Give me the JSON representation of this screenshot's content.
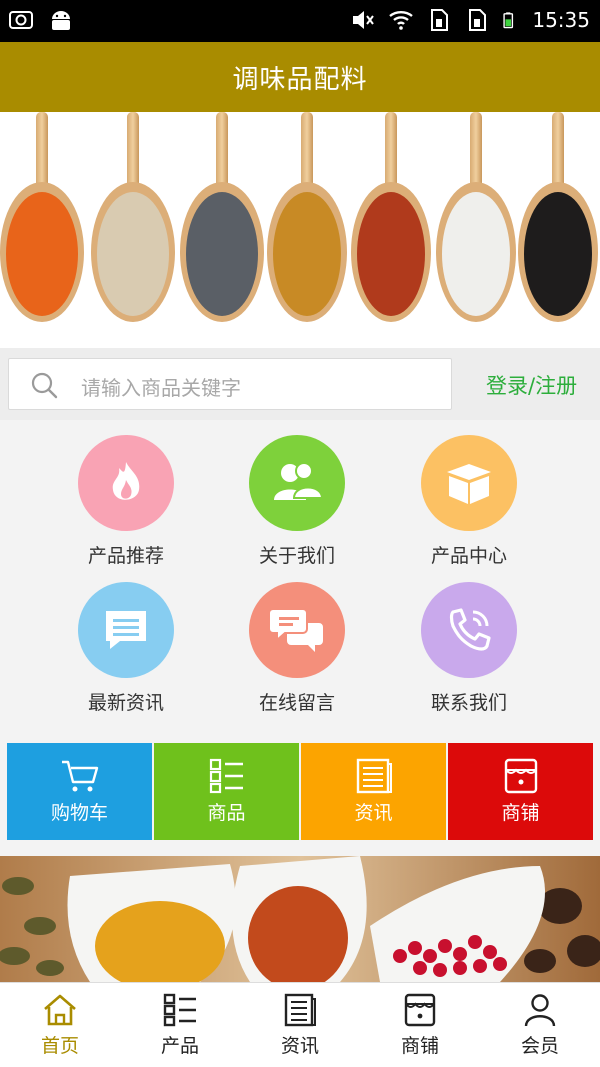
{
  "status_bar": {
    "time": "15:35",
    "left_icons": [
      "screenshot-icon",
      "android-icon"
    ],
    "right_icons": [
      "mute-icon",
      "wifi-icon",
      "sim1-icon",
      "sim2-icon",
      "battery-icon"
    ]
  },
  "header": {
    "title": "调味品配料"
  },
  "search": {
    "placeholder": "请输入商品关键字",
    "login_label": "登录/注册"
  },
  "grid": {
    "items": [
      {
        "label": "产品推荐",
        "icon": "flame-icon",
        "color": "#f9a3b4"
      },
      {
        "label": "关于我们",
        "icon": "people-icon",
        "color": "#7ed13b"
      },
      {
        "label": "产品中心",
        "icon": "box-icon",
        "color": "#fcc163"
      },
      {
        "label": "最新资讯",
        "icon": "chat-doc-icon",
        "color": "#87cdf1"
      },
      {
        "label": "在线留言",
        "icon": "chat-bubbles-icon",
        "color": "#f48f7b"
      },
      {
        "label": "联系我们",
        "icon": "phone-icon",
        "color": "#c9a9ec"
      }
    ]
  },
  "tiles": [
    {
      "label": "购物车",
      "icon": "cart-icon",
      "color": "#1e9fe0"
    },
    {
      "label": "商品",
      "icon": "list-icon",
      "color": "#6fc11c"
    },
    {
      "label": "资讯",
      "icon": "news-icon",
      "color": "#fca400"
    },
    {
      "label": "商铺",
      "icon": "store-icon",
      "color": "#dc0a0a"
    }
  ],
  "bottom_nav": {
    "items": [
      {
        "label": "首页",
        "icon": "home-icon",
        "active": true
      },
      {
        "label": "产品",
        "icon": "grid-list-icon",
        "active": false
      },
      {
        "label": "资讯",
        "icon": "news-icon",
        "active": false
      },
      {
        "label": "商铺",
        "icon": "store-icon",
        "active": false
      },
      {
        "label": "会员",
        "icon": "user-icon",
        "active": false
      }
    ]
  },
  "colors": {
    "header": "#a98c00",
    "login": "#2dae3c",
    "nav_active": "#a98c00"
  }
}
